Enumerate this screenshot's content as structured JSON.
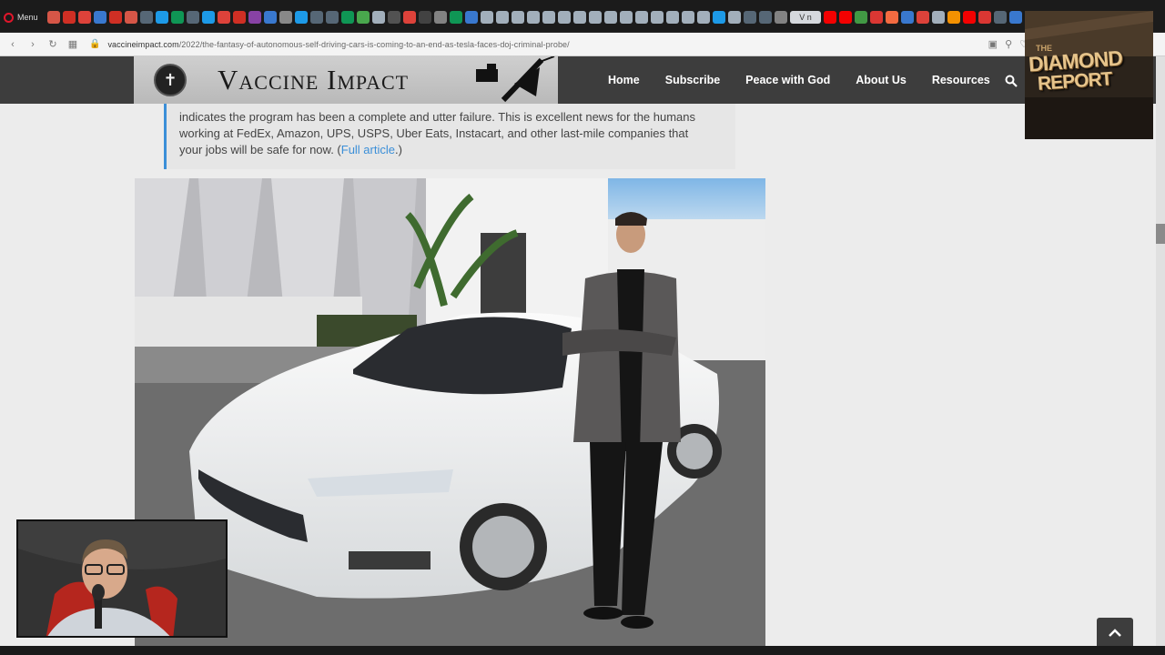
{
  "browser": {
    "menu_label": "Menu",
    "active_tab_label": "V n",
    "url_host": "vaccineimpact.com",
    "url_path": "/2022/the-fantasy-of-autonomous-self-driving-cars-is-coming-to-an-end-as-tesla-faces-doj-criminal-probe/",
    "tab_colors": [
      "#e05a4a",
      "#d93025",
      "#e8453c",
      "#3b7dd8",
      "#d93025",
      "#e05a4a",
      "#5a6b7b",
      "#1da1f2",
      "#0f9d58",
      "#5a6b7b",
      "#1da1f2",
      "#e8453c",
      "#d93025",
      "#8e44ad",
      "#3b7dd8",
      "#8e8e8e",
      "#1da1f2",
      "#5a6b7b",
      "#5a6b7b",
      "#0f9d58",
      "#4caf50",
      "#aab7c4",
      "#555555",
      "#e8453c",
      "#444444",
      "#888888",
      "#0f9d58",
      "#3b7dd8",
      "#aab7c4",
      "#aab7c4",
      "#aab7c4",
      "#aab7c4",
      "#aab7c4",
      "#aab7c4",
      "#aab7c4",
      "#aab7c4",
      "#aab7c4",
      "#aab7c4",
      "#aab7c4",
      "#aab7c4",
      "#aab7c4",
      "#aab7c4",
      "#aab7c4",
      "#1da1f2",
      "#aab7c4",
      "#5a6b7b",
      "#5a6b7b",
      "#888888"
    ],
    "tab_colors_right": [
      "#ff0000",
      "#ff0000",
      "#43a047",
      "#e53935",
      "#ff7043",
      "#3b7dd8",
      "#e8453c",
      "#aab7c4",
      "#ff9800",
      "#ff0000",
      "#e53935",
      "#5a6b7b",
      "#3b7dd8"
    ]
  },
  "site": {
    "logo_text": "Vaccine Impact",
    "nav": [
      "Home",
      "Subscribe",
      "Peace with God",
      "About Us",
      "Resources"
    ]
  },
  "article": {
    "quote_line1": "indicates the program has been a complete and utter failure. This is excellent news for the humans",
    "quote_line2": "working at FedEx, Amazon, UPS, USPS, Uber Eats, Instacart, and other last-mile companies that",
    "quote_line3_pre": "your jobs will be safe for now. (",
    "quote_link": "Full article",
    "quote_line3_post": ".)"
  },
  "overlay": {
    "report_line1": "THE",
    "report_line2": "DIAMOND",
    "report_line3": "REPORT"
  },
  "colors": {
    "link_blue": "#3b8fd8",
    "header_dark": "#3d3d3d"
  }
}
